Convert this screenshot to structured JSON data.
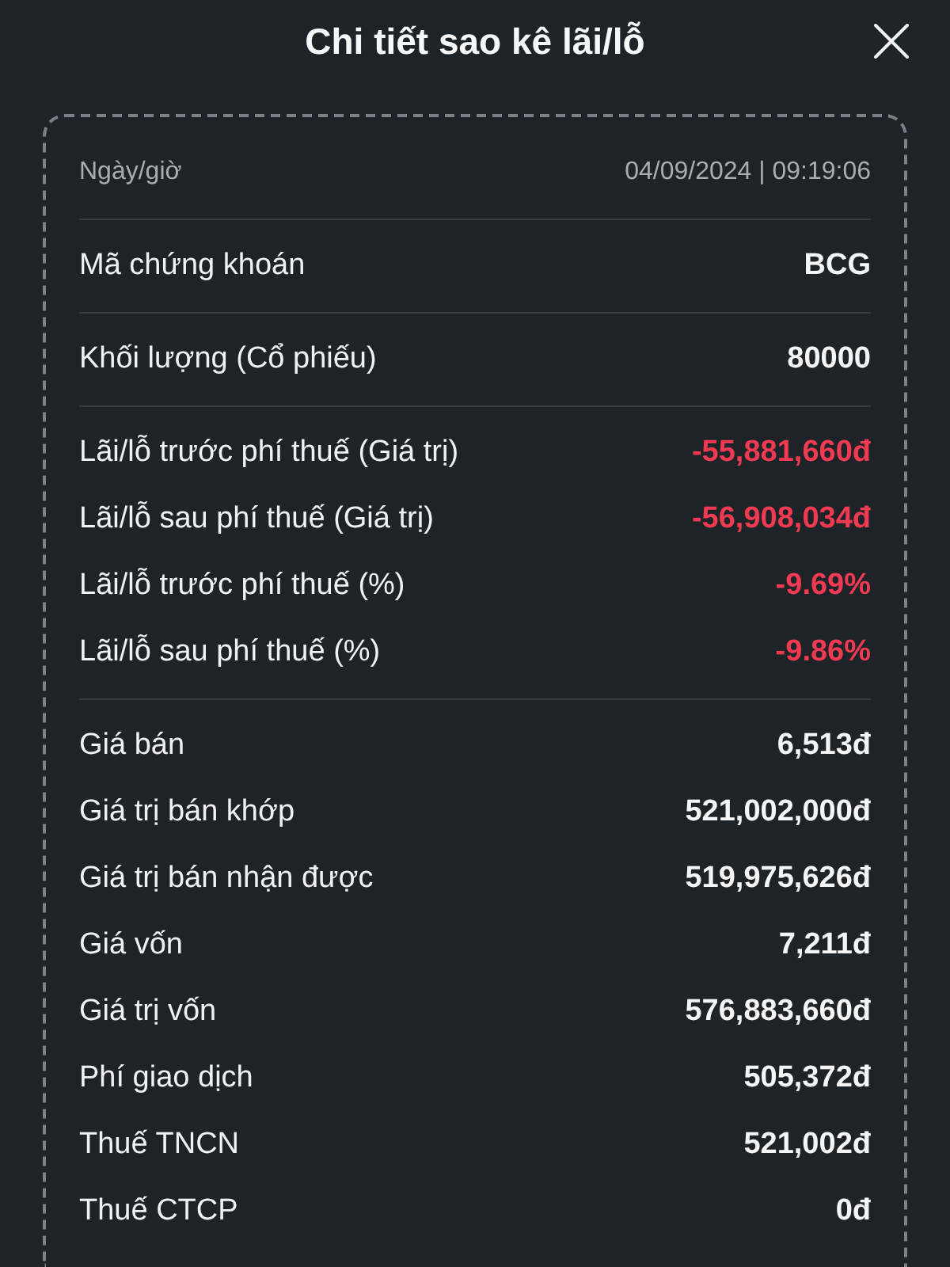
{
  "header": {
    "title": "Chi tiết sao kê lãi/lỗ"
  },
  "statement": {
    "groups": [
      {
        "rows": [
          {
            "kind": "meta",
            "label": "Ngày/giờ",
            "value": "04/09/2024 | 09:19:06",
            "negative": false
          }
        ]
      },
      {
        "rows": [
          {
            "kind": "field",
            "label": "Mã chứng khoán",
            "value": "BCG",
            "negative": false
          }
        ]
      },
      {
        "rows": [
          {
            "kind": "field",
            "label": "Khối lượng (Cổ phiếu)",
            "value": "80000",
            "negative": false
          }
        ]
      },
      {
        "rows": [
          {
            "kind": "field",
            "label": "Lãi/lỗ trước phí thuế (Giá trị)",
            "value": "-55,881,660đ",
            "negative": true
          },
          {
            "kind": "field",
            "label": "Lãi/lỗ sau phí thuế (Giá trị)",
            "value": "-56,908,034đ",
            "negative": true
          },
          {
            "kind": "field",
            "label": "Lãi/lỗ trước phí thuế (%)",
            "value": "-9.69%",
            "negative": true
          },
          {
            "kind": "field",
            "label": "Lãi/lỗ sau phí thuế (%)",
            "value": "-9.86%",
            "negative": true
          }
        ]
      },
      {
        "rows": [
          {
            "kind": "field",
            "label": "Giá bán",
            "value": "6,513đ",
            "negative": false
          },
          {
            "kind": "field",
            "label": "Giá trị bán khớp",
            "value": "521,002,000đ",
            "negative": false
          },
          {
            "kind": "field",
            "label": "Giá trị bán nhận được",
            "value": "519,975,626đ",
            "negative": false
          },
          {
            "kind": "field",
            "label": "Giá vốn",
            "value": "7,211đ",
            "negative": false
          },
          {
            "kind": "field",
            "label": "Giá trị vốn",
            "value": "576,883,660đ",
            "negative": false
          },
          {
            "kind": "field",
            "label": "Phí giao dịch",
            "value": "505,372đ",
            "negative": false
          },
          {
            "kind": "field",
            "label": "Thuế TNCN",
            "value": "521,002đ",
            "negative": false
          },
          {
            "kind": "field",
            "label": "Thuế CTCP",
            "value": "0đ",
            "negative": false
          }
        ]
      }
    ]
  }
}
